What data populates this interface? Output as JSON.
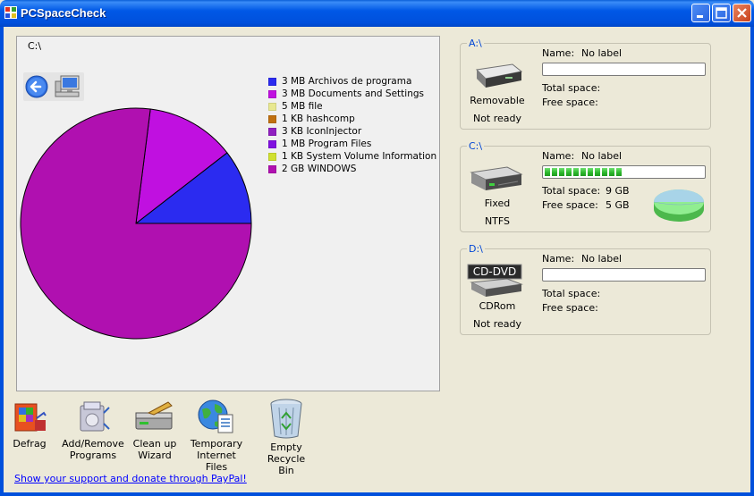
{
  "window": {
    "title": "PCSpaceCheck"
  },
  "chart_panel": {
    "path": "C:\\",
    "legend": [
      {
        "label": "3 MB Archivos de programa",
        "color": "#2B2BF0"
      },
      {
        "label": "3 MB Documents and Settings",
        "color": "#C010E0"
      },
      {
        "label": "5 MB file",
        "color": "#E8E890"
      },
      {
        "label": "1 KB hashcomp",
        "color": "#C07010"
      },
      {
        "label": "3 KB IconInjector",
        "color": "#9020C0"
      },
      {
        "label": "1 MB Program Files",
        "color": "#8010E0"
      },
      {
        "label": "1 KB System Volume Information",
        "color": "#D0E030"
      },
      {
        "label": "2 GB WINDOWS",
        "color": "#B010B0"
      }
    ]
  },
  "chart_data": {
    "type": "pie",
    "categories": [
      "Archivos de programa",
      "Documents and Settings",
      "WINDOWS"
    ],
    "values": [
      10.5,
      12.5,
      77.0
    ],
    "colors": [
      "#2B2BF0",
      "#C010E0",
      "#B010B0"
    ]
  },
  "drives": [
    {
      "letter": "A:\\",
      "name_label": "Name:",
      "name_value": "No label",
      "type": "Removable",
      "status": "Not ready",
      "total_label": "Total space:",
      "total_value": "",
      "free_label": "Free space:",
      "free_value": "",
      "usage": 0
    },
    {
      "letter": "C:\\",
      "name_label": "Name:",
      "name_value": "No label",
      "type": "Fixed",
      "status": "NTFS",
      "total_label": "Total space:",
      "total_value": "9 GB",
      "free_label": "Free space:",
      "free_value": "5 GB",
      "usage": 0.5
    },
    {
      "letter": "D:\\",
      "name_label": "Name:",
      "name_value": "No label",
      "type": "CDRom",
      "status": "Not ready",
      "total_label": "Total space:",
      "total_value": "",
      "free_label": "Free space:",
      "free_value": "",
      "usage": 0,
      "icon_text": "CD-DVD"
    }
  ],
  "tools": [
    {
      "label1": "Defrag",
      "label2": ""
    },
    {
      "label1": "Add/Remove",
      "label2": "Programs"
    },
    {
      "label1": "Clean up",
      "label2": "Wizard"
    },
    {
      "label1": "Temporary",
      "label2": "Internet Files"
    },
    {
      "label1": "Empty Recycle",
      "label2": "Bin"
    }
  ],
  "footer": {
    "paypal_link": "Show your support and donate through PayPal!"
  }
}
